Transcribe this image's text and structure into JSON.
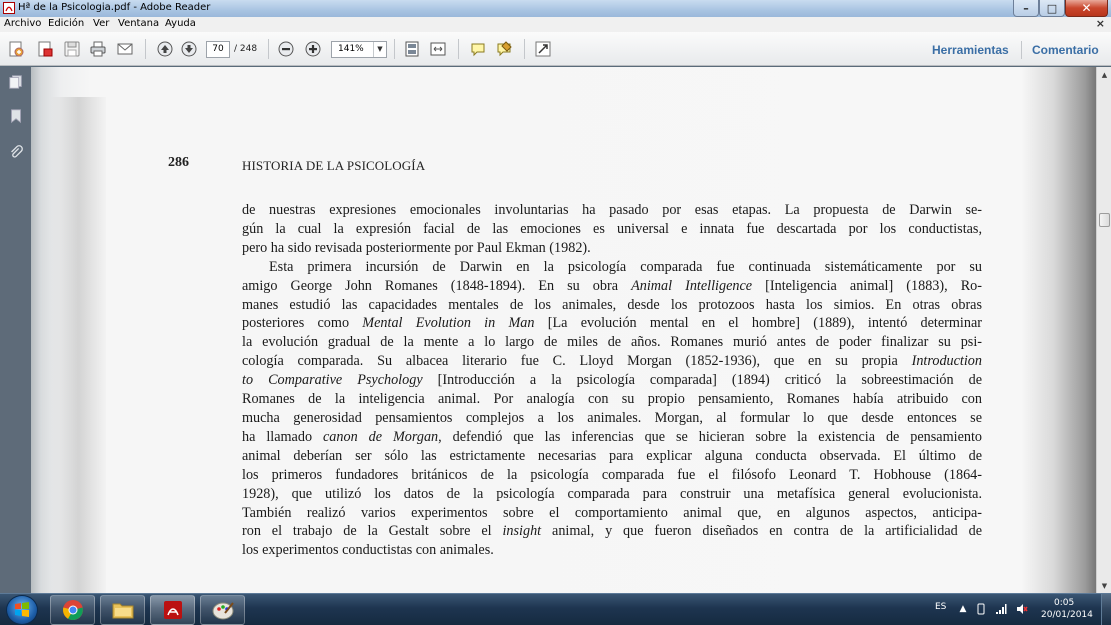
{
  "window": {
    "title": "Hª de la Psicologia.pdf - Adobe Reader",
    "minimize_glyph": "–",
    "maximize_glyph": "□",
    "close_glyph": "✕"
  },
  "menu": {
    "items": [
      "Archivo",
      "Edición",
      "Ver",
      "Ventana",
      "Ayuda"
    ],
    "close_glyph": "×"
  },
  "toolbar": {
    "current_page": "70",
    "total_pages": "/ 248",
    "zoom": "141%",
    "tools_label": "Herramientas",
    "comment_label": "Comentario"
  },
  "document": {
    "page_number": "286",
    "running_head": "HISTORIA DE LA PSICOLOGÍA",
    "lines": [
      "de nuestras expresiones emocionales involuntarias ha pasado por esas etapas. La propuesta de Darwin se-",
      "gún la cual la expresión facial de las emociones es universal e innata fue descartada por los conductistas,",
      "pero ha sido revisada posteriormente por Paul Ekman (1982).",
      "Esta primera incursión de Darwin en la psicología comparada fue continuada sistemáticamente por su",
      "amigo George John Romanes (1848-1894). En su obra ",
      "Animal Intelligence",
      " [Inteligencia animal] (1883), Ro-",
      "manes estudió las capacidades mentales de los animales, desde los protozoos hasta los simios. En otras obras",
      "posteriores como ",
      "Mental Evolution in Man",
      " [La evolución mental en el hombre] (1889), intentó determinar",
      "la evolución gradual de la mente a lo largo de miles de años. Romanes murió antes de poder finalizar su psi-",
      "cología comparada. Su albacea literario fue C. Lloyd Morgan (1852-1936), que en su propia ",
      "Introduction",
      "to Comparative Psychology",
      " [Introducción a la psicología comparada] (1894) criticó la sobreestimación de",
      "Romanes de la inteligencia animal. Por analogía con su propio pensamiento, Romanes había atribuido con",
      "mucha generosidad pensamientos complejos a los animales. Morgan, al formular lo que desde entonces se",
      "ha llamado ",
      "canon de Morgan",
      ", defendió que las inferencias que se hicieran sobre la existencia de pensamiento",
      "animal deberían ser sólo las estrictamente necesarias para explicar alguna conducta observada. El último de",
      "los primeros fundadores británicos de la psicología comparada fue el filósofo Leonard T. Hobhouse (1864-",
      "1928), que utilizó los datos de la psicología comparada para construir una metafísica general evolucionista.",
      "También realizó varios experimentos sobre el comportamiento animal que, en algunos aspectos, anticipa-",
      "ron el trabajo de la Gestalt sobre el ",
      "insight",
      " animal, y que fueron diseñados en contra de la artificialidad de",
      "los experimentos conductistas con animales."
    ]
  },
  "taskbar": {
    "lang": "ES",
    "time": "0:05",
    "date": "20/01/2014"
  },
  "icons": {
    "app": "adobe-reader-icon",
    "scroll_up": "▲",
    "scroll_down": "▼",
    "tray_up": "▲",
    "zoom_dropdown": "▼"
  }
}
